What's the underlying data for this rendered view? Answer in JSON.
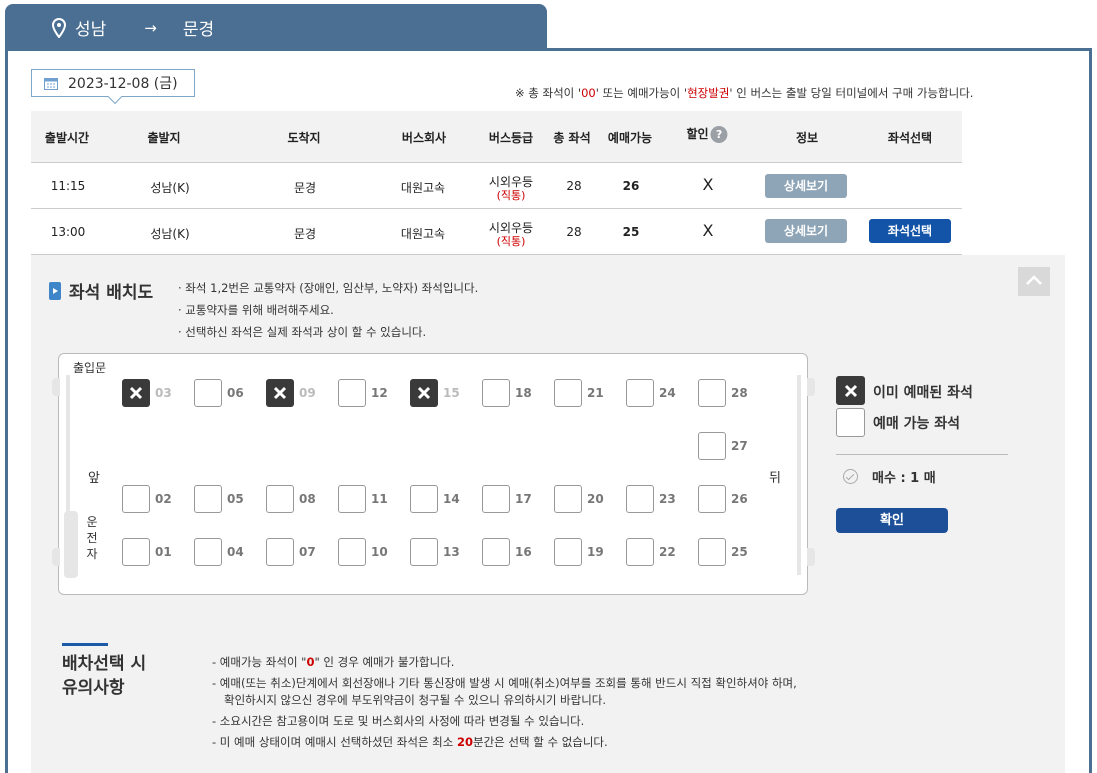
{
  "route": {
    "origin": "성남",
    "arrow": "→",
    "destination": "문경"
  },
  "date": {
    "label": "2023-12-08 (금)"
  },
  "notice": {
    "prefix": "※ 총 좌석이 '",
    "zero": "00",
    "mid": "' 또는 예매가능이 '",
    "onsite": "현장발권",
    "suffix": "' 인 버스는 출발 당일 터미널에서 구매 가능합니다."
  },
  "table": {
    "headers": {
      "depart_time": "출발시간",
      "origin": "출발지",
      "destination": "도착지",
      "company": "버스회사",
      "grade": "버스등급",
      "total_seats": "총 좌석",
      "available": "예매가능",
      "discount": "할인",
      "info": "정보",
      "seat_select": "좌석선택"
    },
    "help_icon": "?",
    "rows": [
      {
        "time": "11:15",
        "origin": "성남(K)",
        "destination": "문경",
        "company": "대원고속",
        "grade": "시외우등",
        "grade_sub": "(직통)",
        "total": "28",
        "available": "26",
        "discount": "X",
        "detail_btn": "상세보기",
        "seat_btn": ""
      },
      {
        "time": "13:00",
        "origin": "성남(K)",
        "destination": "문경",
        "company": "대원고속",
        "grade": "시외우등",
        "grade_sub": "(직통)",
        "total": "28",
        "available": "25",
        "discount": "X",
        "detail_btn": "상세보기",
        "seat_btn": "좌석선택"
      }
    ]
  },
  "seatmap": {
    "title": "좌석 배치도",
    "notes": [
      "· 좌석 1,2번은 교통약자 (장애인, 임산부, 노약자) 좌석입니다.",
      "· 교통약자를 위해 배려해주세요.",
      "· 선택하신 좌석은 실제 좌석과 상이 할 수 있습니다."
    ],
    "labels": {
      "door": "출입문",
      "front": "앞",
      "back": "뒤",
      "driver": "운전자"
    },
    "seats": [
      {
        "num": "03",
        "taken": true
      },
      {
        "num": "06",
        "taken": false
      },
      {
        "num": "09",
        "taken": true
      },
      {
        "num": "12",
        "taken": false
      },
      {
        "num": "15",
        "taken": true
      },
      {
        "num": "18",
        "taken": false
      },
      {
        "num": "21",
        "taken": false
      },
      {
        "num": "24",
        "taken": false
      },
      {
        "num": "28",
        "taken": false
      },
      {
        "num": "27",
        "taken": false
      },
      {
        "num": "02",
        "taken": false
      },
      {
        "num": "05",
        "taken": false
      },
      {
        "num": "08",
        "taken": false
      },
      {
        "num": "11",
        "taken": false
      },
      {
        "num": "14",
        "taken": false
      },
      {
        "num": "17",
        "taken": false
      },
      {
        "num": "20",
        "taken": false
      },
      {
        "num": "23",
        "taken": false
      },
      {
        "num": "26",
        "taken": false
      },
      {
        "num": "01",
        "taken": false
      },
      {
        "num": "04",
        "taken": false
      },
      {
        "num": "07",
        "taken": false
      },
      {
        "num": "10",
        "taken": false
      },
      {
        "num": "13",
        "taken": false
      },
      {
        "num": "16",
        "taken": false
      },
      {
        "num": "19",
        "taken": false
      },
      {
        "num": "22",
        "taken": false
      },
      {
        "num": "25",
        "taken": false
      }
    ],
    "legend": {
      "taken": "이미 예매된 좌석",
      "available": "예매 가능 좌석"
    },
    "count": "매수 : 1 매",
    "confirm_btn": "확인"
  },
  "caution": {
    "title": "배차선택 시 유의사항",
    "items": {
      "i1_a": "- 예매가능 좌석이 \"",
      "i1_red": "0",
      "i1_b": "\" 인 경우 예매가 불가합니다.",
      "i2_a": "- 예매(또는 취소)단계에서 회선장애나 기타 통신장애 발생 시 예매(취소)여부를 조회를 통해 반드시 직접 확인하셔야 하며,",
      "i2_b": "확인하시지 않으신 경우에 부도위약금이 청구될 수 있으니 유의하시기 바랍니다.",
      "i3": "- 소요시간은 참고용이며 도로 및 버스회사의 사정에 따라 변경될 수 있습니다.",
      "i4_a": "- 미 예매 상태이며 예매시 선택하셨던 좌석은 최소 ",
      "i4_red": "20",
      "i4_b": "분간은 선택 할 수 없습니다."
    }
  },
  "colors": {
    "header_blue": "#4a6f92",
    "primary_button": "#1454a8",
    "detail_button": "#8ea4b7",
    "alert_red": "#cc0000"
  }
}
